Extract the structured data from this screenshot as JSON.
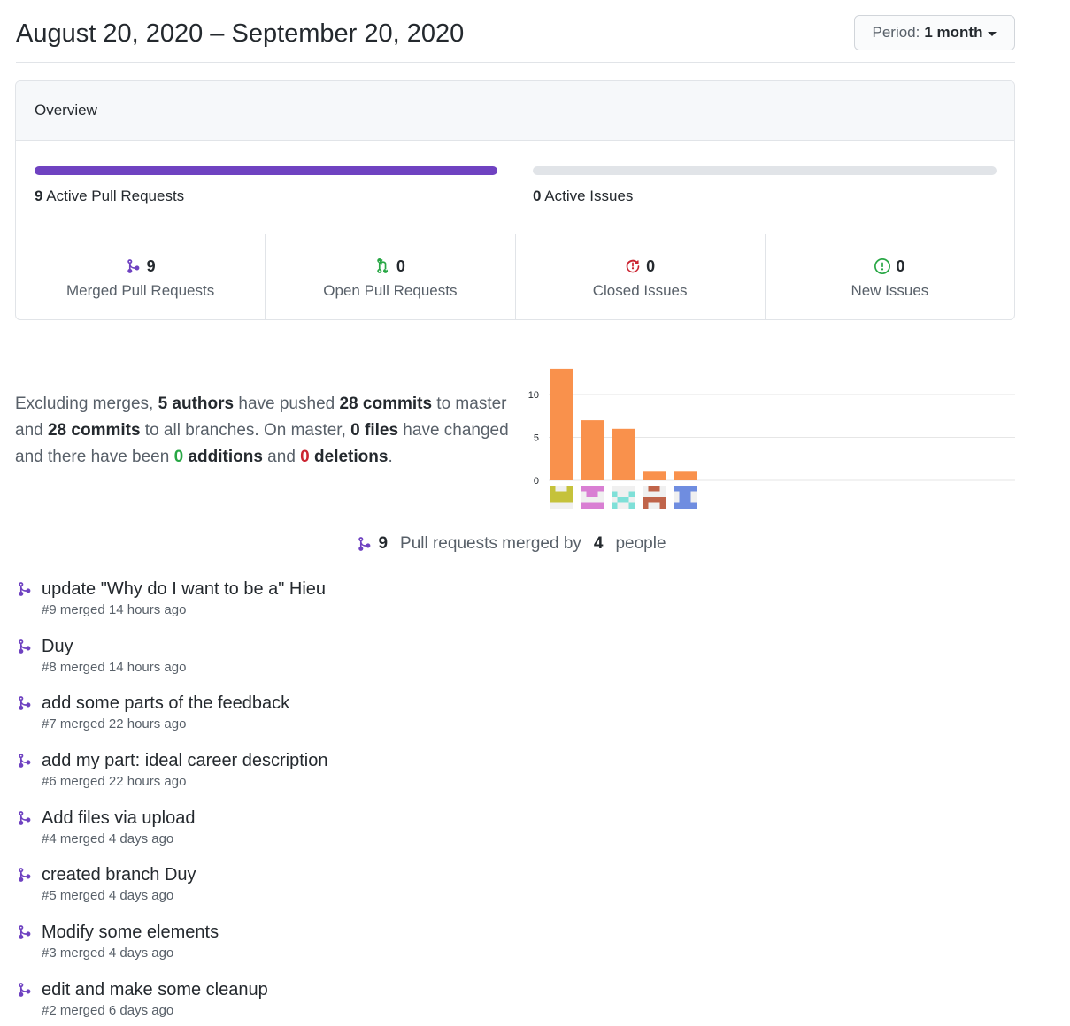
{
  "header": {
    "date_range": "August 20, 2020 – September 20, 2020",
    "period_label": "Period:",
    "period_value": "1 month"
  },
  "overview": {
    "title": "Overview",
    "pull_requests": {
      "count": "9",
      "label": "Active Pull Requests",
      "fill_fraction": 1.0,
      "color": "#6f42c1"
    },
    "issues": {
      "count": "0",
      "label": "Active Issues",
      "fill_fraction": 0.0,
      "color": "#e1e4e8"
    },
    "stats": [
      {
        "icon": "git-merge-icon",
        "count": "9",
        "label": "Merged Pull Requests",
        "color": "#6f42c1"
      },
      {
        "icon": "git-pull-request-icon",
        "count": "0",
        "label": "Open Pull Requests",
        "color": "#28a745"
      },
      {
        "icon": "issue-closed-icon",
        "count": "0",
        "label": "Closed Issues",
        "color": "#cb2431"
      },
      {
        "icon": "issue-opened-icon",
        "count": "0",
        "label": "New Issues",
        "color": "#28a745"
      }
    ]
  },
  "summary": {
    "t1": "Excluding merges, ",
    "authors": "5 authors",
    "t2": " have pushed ",
    "commits_master": "28 commits",
    "t3": " to master and ",
    "commits_all": "28 commits",
    "t4": " to all branches. On master, ",
    "files": "0 files",
    "t5": " have changed and there have been ",
    "additions_num": "0",
    "additions_word": " additions",
    "t6": " and ",
    "deletions_num": "0",
    "deletions_word": " deletions",
    "t7": "."
  },
  "chart_data": {
    "type": "bar",
    "categories": [
      "author 1",
      "author 2",
      "author 3",
      "author 4",
      "author 5"
    ],
    "values": [
      13,
      7,
      6,
      1,
      1
    ],
    "yticks": [
      0,
      5,
      10
    ],
    "ylim": [
      0,
      13
    ],
    "bar_color": "#f9914c",
    "grid": true,
    "avatar_colors": [
      "#c5c23b",
      "#d97fd3",
      "#7fe0d8",
      "#c0644a",
      "#6f8de0"
    ]
  },
  "merged_divider": {
    "count": "9",
    "t1": " Pull requests merged by ",
    "people": "4",
    "t2": " people"
  },
  "pull_requests": [
    {
      "title": "update \"Why do I want to be a\" Hieu",
      "meta": "#9 merged 14 hours ago"
    },
    {
      "title": "Duy",
      "meta": "#8 merged 14 hours ago"
    },
    {
      "title": "add some parts of the feedback",
      "meta": "#7 merged 22 hours ago"
    },
    {
      "title": "add my part: ideal career description",
      "meta": "#6 merged 22 hours ago"
    },
    {
      "title": "Add files via upload",
      "meta": "#4 merged 4 days ago"
    },
    {
      "title": "created branch Duy",
      "meta": "#5 merged 4 days ago"
    },
    {
      "title": "Modify some elements",
      "meta": "#3 merged 4 days ago"
    },
    {
      "title": "edit and make some cleanup",
      "meta": "#2 merged 6 days ago"
    }
  ]
}
